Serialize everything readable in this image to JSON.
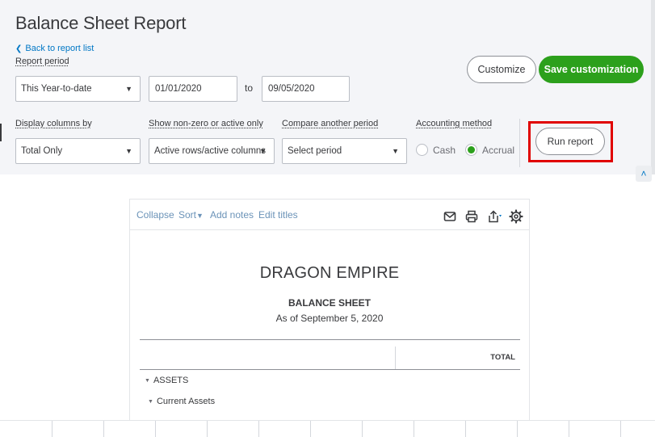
{
  "header": {
    "title": "Balance Sheet Report",
    "back_link": "Back to report list",
    "customize_label": "Customize",
    "save_label": "Save customization"
  },
  "filters": {
    "report_period": {
      "label": "Report period",
      "value": "This Year-to-date",
      "from_date": "01/01/2020",
      "to_label": "to",
      "to_date": "09/05/2020"
    },
    "display_columns": {
      "label": "Display columns by",
      "value": "Total Only"
    },
    "show_nonzero": {
      "label": "Show non-zero or active only",
      "value": "Active rows/active columns"
    },
    "compare_period": {
      "label": "Compare another period",
      "value": "Select period"
    },
    "accounting_method": {
      "label": "Accounting method",
      "options": [
        "Cash",
        "Accrual"
      ],
      "selected": "Accrual"
    },
    "run_label": "Run report"
  },
  "toolbar": {
    "collapse": "Collapse",
    "sort": "Sort",
    "add_notes": "Add notes",
    "edit_titles": "Edit titles",
    "icons": [
      "email-icon",
      "print-icon",
      "export-icon",
      "settings-icon"
    ]
  },
  "report": {
    "company": "DRAGON EMPIRE",
    "name": "BALANCE SHEET",
    "date": "As of September 5, 2020",
    "total_header": "TOTAL",
    "rows": [
      {
        "label": "ASSETS"
      },
      {
        "label": "Current Assets"
      }
    ]
  },
  "colors": {
    "accent_green": "#2ca01c",
    "link_blue": "#0077c5",
    "highlight_red": "#e00000",
    "panel_bg": "#f4f5f8"
  }
}
